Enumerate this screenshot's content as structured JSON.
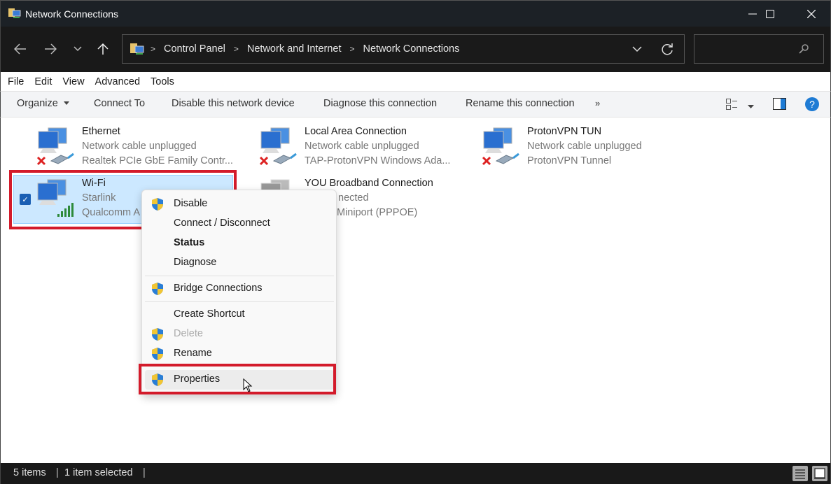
{
  "window": {
    "title": "Network Connections",
    "controls": {
      "minimize": "minimize-icon",
      "maximize": "maximize-icon",
      "close": "close-icon"
    }
  },
  "navigation": {
    "back": "back-arrow-icon",
    "forward": "forward-arrow-icon",
    "recent": "chevron-down-icon",
    "up": "up-arrow-icon",
    "breadcrumbs": [
      "Control Panel",
      "Network and Internet",
      "Network Connections"
    ],
    "search_placeholder": ""
  },
  "menubar": {
    "items": [
      "File",
      "Edit",
      "View",
      "Advanced",
      "Tools"
    ]
  },
  "commandbar": {
    "organize": "Organize",
    "connect_to": "Connect To",
    "disable": "Disable this network device",
    "diagnose": "Diagnose this connection",
    "rename": "Rename this connection",
    "more": "»"
  },
  "connections": [
    {
      "name": "Ethernet",
      "status": "Network cable unplugged",
      "device": "Realtek PCIe GbE Family Contr...",
      "state": "disconnected"
    },
    {
      "name": "Local Area Connection",
      "status": "Network cable unplugged",
      "device": "TAP-ProtonVPN Windows Ada...",
      "state": "disconnected"
    },
    {
      "name": "ProtonVPN TUN",
      "status": "Network cable unplugged",
      "device": "ProtonVPN Tunnel",
      "state": "disconnected"
    },
    {
      "name": "Wi-Fi",
      "status": "Starlink",
      "device": "Qualcomm A",
      "state": "connected",
      "selected": true
    },
    {
      "name": "YOU Broadband Connection",
      "status": "nected",
      "device": "Miniport (PPPOE)",
      "state": "disconnected"
    }
  ],
  "context_menu": {
    "items": [
      {
        "label": "Disable",
        "shield": true
      },
      {
        "label": "Connect / Disconnect",
        "shield": false
      },
      {
        "label": "Status",
        "shield": false,
        "bold": true
      },
      {
        "label": "Diagnose",
        "shield": false
      },
      {
        "label": "Bridge Connections",
        "shield": true
      },
      {
        "label": "Create Shortcut",
        "shield": false
      },
      {
        "label": "Delete",
        "shield": true,
        "disabled": true
      },
      {
        "label": "Rename",
        "shield": true
      },
      {
        "label": "Properties",
        "shield": true,
        "highlighted": true
      }
    ]
  },
  "statusbar": {
    "count": "5 items",
    "selection": "1 item selected"
  },
  "colors": {
    "highlight_red": "#d31b2b",
    "selection_bg": "#cce8ff",
    "help_blue": "#1e7bd4"
  }
}
